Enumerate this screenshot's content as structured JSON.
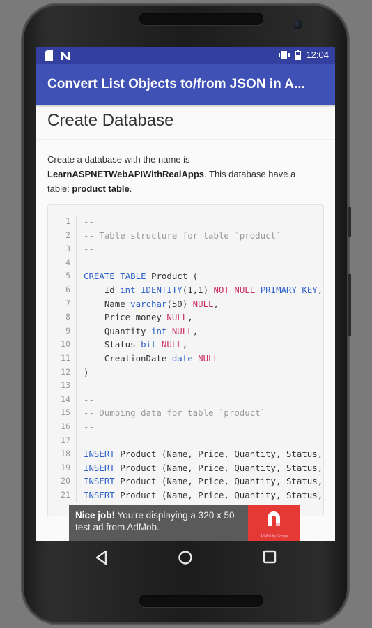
{
  "status_bar": {
    "time": "12:04",
    "icons": [
      "sd-card-icon",
      "notification-n-icon",
      "vibrate-icon",
      "battery-icon"
    ]
  },
  "app_bar": {
    "title": "Convert List Objects to/from JSON in A..."
  },
  "article": {
    "heading": "Create Database",
    "desc_part1": "Create a database with the name is ",
    "desc_bold1": "LearnASPNETWebAPIWithRealApps",
    "desc_part2": ". This database have a table: ",
    "desc_bold2": "product table",
    "desc_part3": "."
  },
  "code": {
    "lines": [
      {
        "n": "1",
        "text": "--"
      },
      {
        "n": "2",
        "text": "-- Table structure for table `product`"
      },
      {
        "n": "3",
        "text": "--"
      },
      {
        "n": "4",
        "text": ""
      },
      {
        "n": "5",
        "text": "CREATE TABLE Product ("
      },
      {
        "n": "6",
        "text": "    Id int IDENTITY(1,1) NOT NULL PRIMARY KEY,"
      },
      {
        "n": "7",
        "text": "    Name varchar(50) NULL,"
      },
      {
        "n": "8",
        "text": "    Price money NULL,"
      },
      {
        "n": "9",
        "text": "    Quantity int NULL,"
      },
      {
        "n": "10",
        "text": "    Status bit NULL,"
      },
      {
        "n": "11",
        "text": "    CreationDate date NULL"
      },
      {
        "n": "12",
        "text": ")"
      },
      {
        "n": "13",
        "text": ""
      },
      {
        "n": "14",
        "text": "--"
      },
      {
        "n": "15",
        "text": "-- Dumping data for table `product`"
      },
      {
        "n": "16",
        "text": "--"
      },
      {
        "n": "17",
        "text": ""
      },
      {
        "n": "18",
        "text": "INSERT Product (Name, Price, Quantity, Status, CreationDate)"
      },
      {
        "n": "19",
        "text": "INSERT Product (Name, Price, Quantity, Status, CreationDate)"
      },
      {
        "n": "20",
        "text": "INSERT Product (Name, Price, Quantity, Status, CreationDate)"
      },
      {
        "n": "21",
        "text": "INSERT Product (Name, Price, Quantity, Status, CreationDate)"
      }
    ]
  },
  "ad": {
    "bold": "Nice job!",
    "text": " You're displaying a 320 x 50 test ad from AdMob.",
    "logo_caption": "AdMob by Google"
  },
  "nav_bar": {
    "buttons": [
      "back-icon",
      "home-icon",
      "recents-icon"
    ]
  },
  "colors": {
    "status_bar": "#3440a0",
    "app_bar": "#3f51b5",
    "keyword": "#2f62c8",
    "null": "#cc2f66",
    "comment": "#9a9a9a",
    "ad_logo": "#e53935"
  }
}
